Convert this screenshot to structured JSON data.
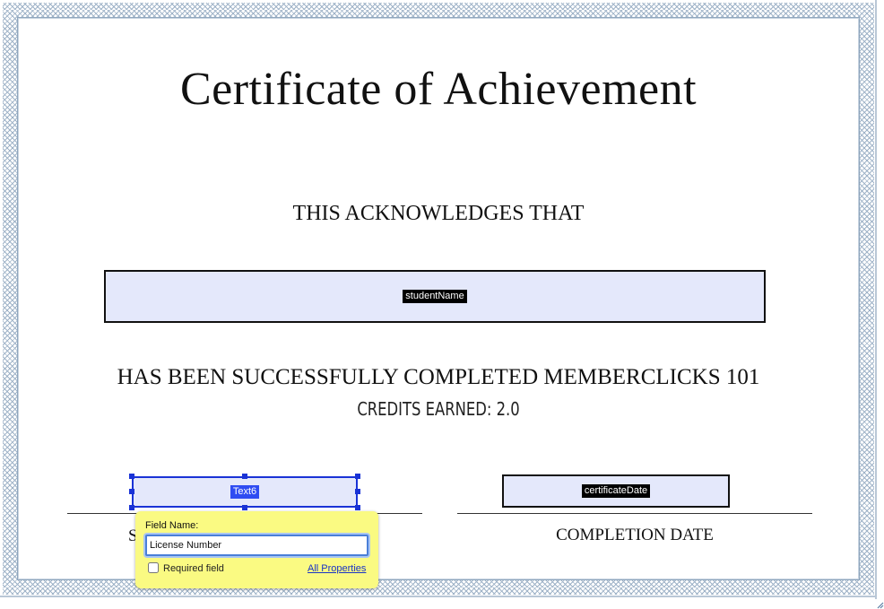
{
  "certificate": {
    "title": "Certificate of Achievement",
    "acknowledges": "THIS ACKNOWLEDGES THAT",
    "completed": "HAS BEEN SUCCESSFULLY COMPLETED MEMBERCLICKS 101",
    "credits": "CREDITS EARNED: 2.0",
    "signature_label_partial": "S",
    "completion_label": "COMPLETION DATE"
  },
  "fields": {
    "student_name": "studentName",
    "text6": "Text6",
    "certificate_date": "certificateDate"
  },
  "field_popup": {
    "label": "Field Name:",
    "value": "License Number",
    "required_label": "Required field",
    "required_checked": false,
    "all_properties_link": "All Properties"
  },
  "colors": {
    "field_fill": "#e4e8fb",
    "selection_blue": "#1a33d6",
    "popup_yellow": "#fafa82"
  }
}
